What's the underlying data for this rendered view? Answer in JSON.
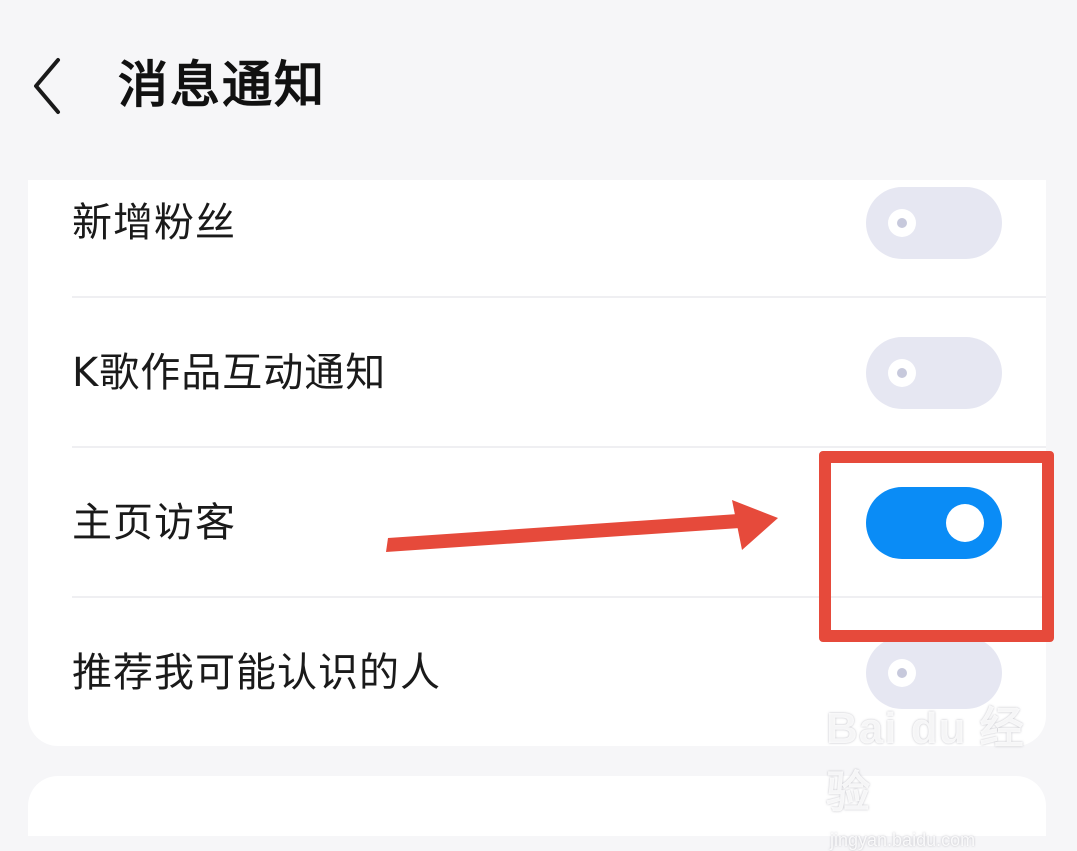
{
  "header": {
    "title": "消息通知",
    "back_icon": "chevron-left-icon"
  },
  "settings": [
    {
      "label": "新增粉丝",
      "enabled": false
    },
    {
      "label": "K歌作品互动通知",
      "enabled": false
    },
    {
      "label": "主页访客",
      "enabled": true
    },
    {
      "label": "推荐我可能认识的人",
      "enabled": false
    }
  ],
  "annotation": {
    "box_color": "#e64a3b",
    "arrow_color": "#e64a3b"
  },
  "watermark": {
    "brand": "Bai du 经验",
    "url": "jingyan.baidu.com"
  },
  "colors": {
    "accent": "#0a8cf6",
    "toggle_off": "#e6e7f2",
    "background": "#f6f6f8"
  }
}
